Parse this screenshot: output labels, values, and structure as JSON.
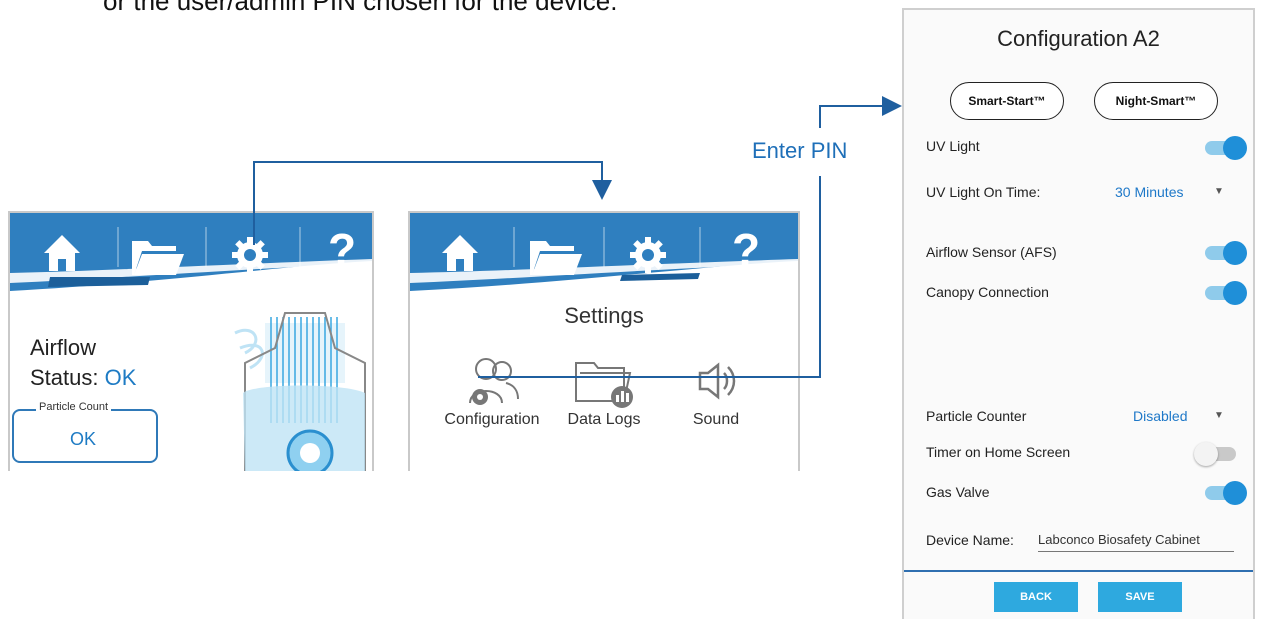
{
  "caption": "or the user/admin PIN chosen for the device.",
  "colors": {
    "toolbar_blue": "#2f7fbf",
    "accent_blue": "#1e7bc4",
    "connector": "#1f5f9f",
    "button_blue": "#2ea9df",
    "toggle_on": "#1f8fd8"
  },
  "left_screen": {
    "toolbar_icons": [
      "home-icon",
      "folder-icon",
      "gear-icon",
      "help-icon"
    ],
    "help_glyph": "?",
    "airflow_label": "Airflow",
    "status_label": "Status:",
    "status_value": "OK",
    "particle_count_label": "Particle Count",
    "particle_count_value": "OK"
  },
  "mid_screen": {
    "toolbar_icons": [
      "home-icon",
      "folder-icon",
      "gear-icon",
      "help-icon"
    ],
    "help_glyph": "?",
    "title": "Settings",
    "items": [
      {
        "icon": "users-gear-icon",
        "label": "Configuration"
      },
      {
        "icon": "folder-chart-icon",
        "label": "Data Logs"
      },
      {
        "icon": "speaker-icon",
        "label": "Sound"
      }
    ]
  },
  "enter_pin_label": "Enter PIN",
  "config_panel": {
    "title": "Configuration A2",
    "smart_start": "Smart-Start™",
    "night_smart": "Night-Smart™",
    "uv_light": {
      "label": "UV Light",
      "on": true
    },
    "uv_light_on_time": {
      "label": "UV Light On Time:",
      "value": "30 Minutes"
    },
    "airflow_sensor": {
      "label": "Airflow Sensor (AFS)",
      "on": true
    },
    "canopy_connection": {
      "label": "Canopy Connection",
      "on": true
    },
    "particle_counter": {
      "label": "Particle Counter",
      "value": "Disabled"
    },
    "timer_home": {
      "label": "Timer on Home Screen",
      "on": false
    },
    "gas_valve": {
      "label": "Gas Valve",
      "on": true
    },
    "device_name": {
      "label": "Device Name:",
      "value": "Labconco Biosafety Cabinet"
    },
    "back_label": "BACK",
    "save_label": "SAVE"
  }
}
